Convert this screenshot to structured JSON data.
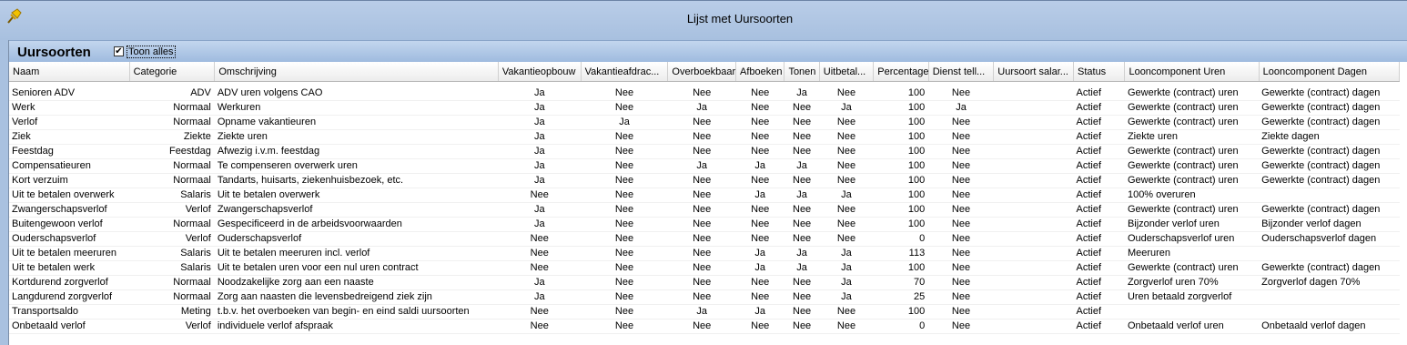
{
  "window": {
    "title": "Lijst met Uursoorten"
  },
  "panel": {
    "title": "Uursoorten",
    "show_all_label": "Toon alles",
    "show_all_checked": "✔"
  },
  "columns": [
    "Naam",
    "Categorie",
    "Omschrijving",
    "Vakantieopbouw",
    "Vakantieafdrac...",
    "Overboekbaar",
    "Afboeken",
    "Tonen",
    "Uitbetal...",
    "Percentage",
    "Dienst tell...",
    "Uursoort salar...",
    "Status",
    "Looncomponent Uren",
    "Looncomponent Dagen"
  ],
  "rows": [
    [
      "Senioren ADV",
      "ADV",
      "ADV uren volgens CAO",
      "Ja",
      "Nee",
      "Nee",
      "Nee",
      "Ja",
      "Nee",
      "100",
      "Nee",
      "",
      "Actief",
      "Gewerkte (contract) uren",
      "Gewerkte (contract) dagen"
    ],
    [
      "Werk",
      "Normaal",
      "Werkuren",
      "Ja",
      "Nee",
      "Ja",
      "Nee",
      "Nee",
      "Ja",
      "100",
      "Ja",
      "",
      "Actief",
      "Gewerkte (contract) uren",
      "Gewerkte (contract) dagen"
    ],
    [
      "Verlof",
      "Normaal",
      "Opname vakantieuren",
      "Ja",
      "Ja",
      "Nee",
      "Nee",
      "Nee",
      "Nee",
      "100",
      "Nee",
      "",
      "Actief",
      "Gewerkte (contract) uren",
      "Gewerkte (contract) dagen"
    ],
    [
      "Ziek",
      "Ziekte",
      "Ziekte uren",
      "Ja",
      "Nee",
      "Nee",
      "Nee",
      "Nee",
      "Nee",
      "100",
      "Nee",
      "",
      "Actief",
      "Ziekte uren",
      "Ziekte dagen"
    ],
    [
      "Feestdag",
      "Feestdag",
      "Afwezig i.v.m. feestdag",
      "Ja",
      "Nee",
      "Nee",
      "Nee",
      "Nee",
      "Nee",
      "100",
      "Nee",
      "",
      "Actief",
      "Gewerkte (contract) uren",
      "Gewerkte (contract) dagen"
    ],
    [
      "Compensatieuren",
      "Normaal",
      "Te compenseren overwerk uren",
      "Ja",
      "Nee",
      "Ja",
      "Ja",
      "Ja",
      "Nee",
      "100",
      "Nee",
      "",
      "Actief",
      "Gewerkte (contract) uren",
      "Gewerkte (contract) dagen"
    ],
    [
      "Kort verzuim",
      "Normaal",
      "Tandarts, huisarts, ziekenhuisbezoek, etc.",
      "Ja",
      "Nee",
      "Nee",
      "Nee",
      "Nee",
      "Nee",
      "100",
      "Nee",
      "",
      "Actief",
      "Gewerkte (contract) uren",
      "Gewerkte (contract) dagen"
    ],
    [
      "Uit te betalen overwerk",
      "Salaris",
      "Uit te betalen overwerk",
      "Nee",
      "Nee",
      "Nee",
      "Ja",
      "Ja",
      "Ja",
      "100",
      "Nee",
      "",
      "Actief",
      "100% overuren",
      ""
    ],
    [
      "Zwangerschapsverlof",
      "Verlof",
      "Zwangerschapsverlof",
      "Ja",
      "Nee",
      "Nee",
      "Nee",
      "Nee",
      "Nee",
      "100",
      "Nee",
      "",
      "Actief",
      "Gewerkte (contract) uren",
      "Gewerkte (contract) dagen"
    ],
    [
      "Buitengewoon verlof",
      "Normaal",
      "Gespecificeerd in de arbeidsvoorwaarden",
      "Ja",
      "Nee",
      "Nee",
      "Nee",
      "Nee",
      "Nee",
      "100",
      "Nee",
      "",
      "Actief",
      "Bijzonder verlof uren",
      "Bijzonder verlof dagen"
    ],
    [
      "Ouderschapsverlof",
      "Verlof",
      "Ouderschapsverlof",
      "Nee",
      "Nee",
      "Nee",
      "Nee",
      "Nee",
      "Nee",
      "0",
      "Nee",
      "",
      "Actief",
      "Ouderschapsverlof uren",
      "Ouderschapsverlof dagen"
    ],
    [
      "Uit te betalen meeruren",
      "Salaris",
      "Uit te betalen meeruren incl. verlof",
      "Nee",
      "Nee",
      "Nee",
      "Ja",
      "Ja",
      "Ja",
      "113",
      "Nee",
      "",
      "Actief",
      "Meeruren",
      ""
    ],
    [
      "Uit te betalen werk",
      "Salaris",
      "Uit te betalen uren voor een nul uren contract",
      "Nee",
      "Nee",
      "Nee",
      "Ja",
      "Ja",
      "Ja",
      "100",
      "Nee",
      "",
      "Actief",
      "Gewerkte (contract) uren",
      "Gewerkte (contract) dagen"
    ],
    [
      "Kortdurend zorgverlof",
      "Normaal",
      "Noodzakelijke zorg aan een naaste",
      "Ja",
      "Nee",
      "Nee",
      "Nee",
      "Nee",
      "Ja",
      "70",
      "Nee",
      "",
      "Actief",
      "Zorgverlof uren 70%",
      "Zorgverlof dagen 70%"
    ],
    [
      "Langdurend zorgverlof",
      "Normaal",
      "Zorg aan naasten die levensbedreigend ziek zijn",
      "Ja",
      "Nee",
      "Nee",
      "Nee",
      "Nee",
      "Ja",
      "25",
      "Nee",
      "",
      "Actief",
      "Uren betaald zorgverlof",
      ""
    ],
    [
      "Transportsaldo",
      "Meting",
      "t.b.v. het overboeken van begin- en eind saldi uursoorten",
      "Nee",
      "Nee",
      "Ja",
      "Ja",
      "Nee",
      "Nee",
      "100",
      "Nee",
      "",
      "Actief",
      "",
      ""
    ],
    [
      "Onbetaald verlof",
      "Verlof",
      "individuele verlof afspraak",
      "Nee",
      "Nee",
      "Nee",
      "Nee",
      "Nee",
      "Nee",
      "0",
      "Nee",
      "",
      "Actief",
      "Onbetaald verlof uren",
      "Onbetaald verlof dagen"
    ]
  ]
}
